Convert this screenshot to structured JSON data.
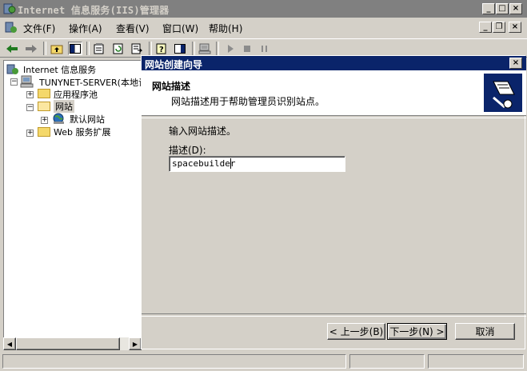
{
  "window": {
    "title": "Internet 信息服务(IIS)管理器",
    "controls": [
      "_",
      "□",
      "×"
    ]
  },
  "menubar": {
    "items": [
      {
        "label": "文件(F)"
      },
      {
        "label": "操作(A)"
      },
      {
        "label": "查看(V)"
      },
      {
        "label": "窗口(W)"
      },
      {
        "label": "帮助(H)"
      }
    ],
    "child_controls": [
      "_",
      "❐",
      "×"
    ]
  },
  "toolbar": {
    "icons": [
      "back-arrow",
      "forward-arrow",
      "up-folder",
      "show-tree",
      "properties",
      "refresh",
      "export",
      "help",
      "show-pane",
      "computer",
      "play",
      "stop",
      "pause"
    ]
  },
  "tree": {
    "root": "Internet 信息服务",
    "server": "TUNYNET-SERVER(本地计",
    "app_pools": "应用程序池",
    "websites": "网站",
    "default_site": "默认网站",
    "web_ext": "Web 服务扩展"
  },
  "wizard": {
    "title": "网站创建向导",
    "close": "×",
    "header_title": "网站描述",
    "header_subtitle": "网站描述用于帮助管理员识别站点。",
    "instruction": "输入网站描述。",
    "field_label": "描述(D):",
    "field_value": "spacebuilder",
    "back_label": "< 上一步(B)",
    "next_label": "下一步(N) >",
    "cancel_label": "取消"
  },
  "colors": {
    "active_title": "#0a246a",
    "inactive_title": "#808080",
    "face": "#d4d0c8"
  }
}
